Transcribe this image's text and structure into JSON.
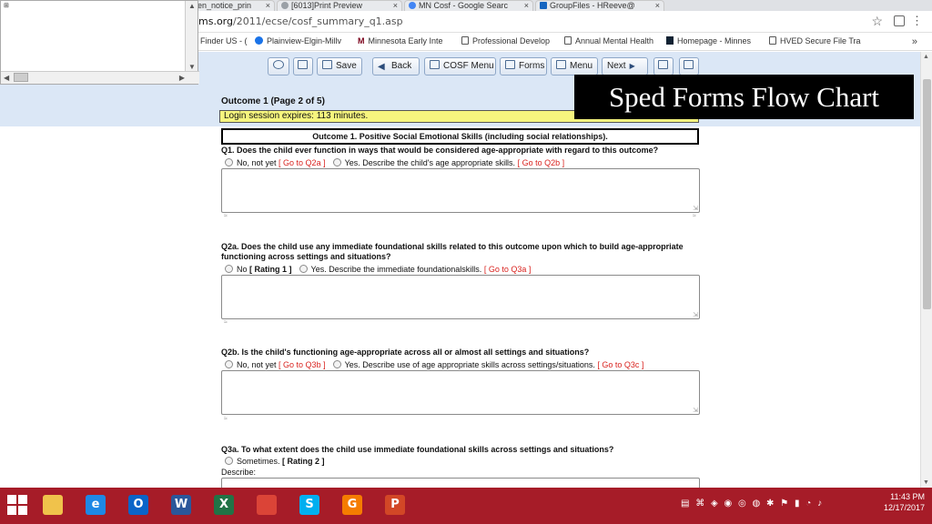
{
  "browser": {
    "tabs": [
      {
        "label": "en_notice_prin"
      },
      {
        "label": "[6013]Print Preview"
      },
      {
        "label": "MN Cosf - Google Searc"
      },
      {
        "label": "GroupFiles - HReeve@"
      }
    ],
    "url_prefix": "ms.org",
    "url_path": "/2011/ecse/cosf_summary_q1.asp",
    "bookmarks": [
      {
        "label": "Finder US - ("
      },
      {
        "label": "Plainview-Elgin-Millv"
      },
      {
        "label": "Minnesota Early Inte"
      },
      {
        "label": "Professional Develop"
      },
      {
        "label": "Annual Mental Health"
      },
      {
        "label": "Homepage - Minnes"
      },
      {
        "label": "HVED Secure File Tra"
      }
    ],
    "more_bookmarks": "»"
  },
  "popup": {
    "grid_glyph": "⊞"
  },
  "toolbar": {
    "save": "Save",
    "back": "Back",
    "cosf_menu": "COSF Menu",
    "forms": "Forms",
    "menu": "Menu",
    "next": "Next"
  },
  "page": {
    "title": "Outcome 1 (Page 2 of 5)",
    "session": "Login session expires: 113 minutes.",
    "outcome_header": "Outcome 1.  Positive Social Emotional Skills (including social relationships)."
  },
  "overlay": {
    "text": "Sped Forms Flow Chart"
  },
  "questions": {
    "q1": {
      "text": "Q1.  Does the child ever function in ways that would be considered age-appropriate with regard to this outcome?",
      "opt1": "No, not yet",
      "opt1_go": "[ Go to Q2a ]",
      "opt2": "Yes. Describe the child's age appropriate skills.",
      "opt2_go": "[ Go to Q2b ]"
    },
    "q2a": {
      "text": "Q2a. Does the child use any immediate foundational skills related to this outcome upon which to build age-appropriate functioning across settings and situations?",
      "opt1": "No",
      "opt1_rating": "[ Rating 1 ]",
      "opt2": "Yes. Describe the immediate foundationalskills.",
      "opt2_go": "[ Go to Q3a ]"
    },
    "q2b": {
      "text": "Q2b. Is the child's functioning age-appropriate across all or almost all settings and situations?",
      "opt1": "No, not yet",
      "opt1_go": "[ Go to Q3b ]",
      "opt2": "Yes. Describe use of age appropriate skills across settings/situations.",
      "opt2_go": "[ Go to Q3c ]"
    },
    "q3a": {
      "text": "Q3a. To what extent does the child use immediate foundational skills across settings and situations?",
      "opt1": "Sometimes.",
      "opt1_rating": "[ Rating 2 ]",
      "describe": "Describe:"
    }
  },
  "taskbar": {
    "apps": [
      {
        "icon": "file-explorer-icon",
        "glyph": "",
        "color": "#f0c24b"
      },
      {
        "icon": "internet-explorer-icon",
        "glyph": "e",
        "color": "#1e88e5"
      },
      {
        "icon": "outlook-icon",
        "glyph": "O",
        "color": "#0a64c8"
      },
      {
        "icon": "word-icon",
        "glyph": "W",
        "color": "#2b579a"
      },
      {
        "icon": "excel-icon",
        "glyph": "X",
        "color": "#217346"
      },
      {
        "icon": "chrome-icon",
        "glyph": "",
        "color": "#db4437"
      },
      {
        "icon": "skype-icon",
        "glyph": "S",
        "color": "#00aff0"
      },
      {
        "icon": "foxit-reader-icon",
        "glyph": "G",
        "color": "#f57c00"
      },
      {
        "icon": "powerpoint-icon",
        "glyph": "P",
        "color": "#d24726"
      }
    ],
    "time": "11:43 PM",
    "date": "12/17/2017"
  }
}
